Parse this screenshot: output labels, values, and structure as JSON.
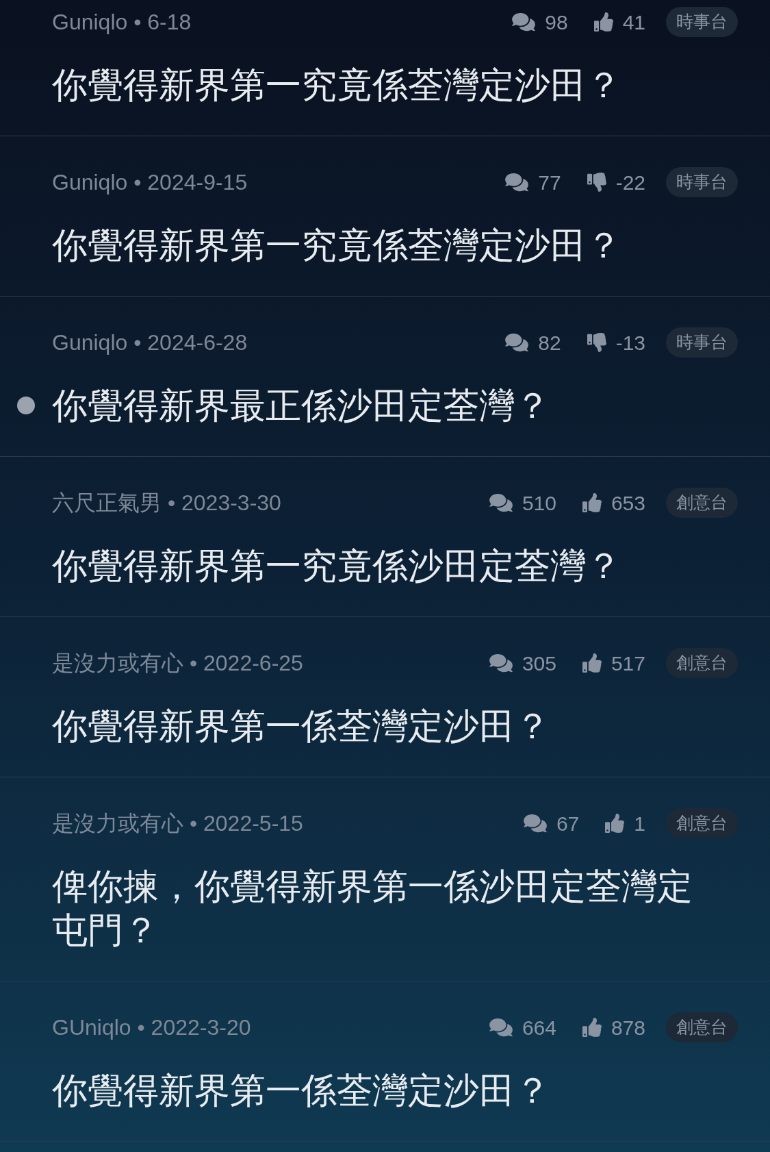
{
  "threads": [
    {
      "byline": "Guniqlo • 6-18",
      "comments": "98",
      "kind": "upvotes",
      "votes": "41",
      "board": "時事台",
      "title": "你覺得新界第一究竟係荃灣定沙田？",
      "unread": false
    },
    {
      "byline": "Guniqlo • 2024-9-15",
      "comments": "77",
      "kind": "downvotes",
      "votes": "-22",
      "board": "時事台",
      "title": "你覺得新界第一究竟係荃灣定沙田？",
      "unread": false
    },
    {
      "byline": "Guniqlo • 2024-6-28",
      "comments": "82",
      "kind": "downvotes",
      "votes": "-13",
      "board": "時事台",
      "title": "你覺得新界最正係沙田定荃灣？",
      "unread": true
    },
    {
      "byline": "六尺正氣男 • 2023-3-30",
      "comments": "510",
      "kind": "upvotes",
      "votes": "653",
      "board": "創意台",
      "title": "你覺得新界第一究竟係沙田定荃灣？",
      "unread": false
    },
    {
      "byline": "是沒力或有心 • 2022-6-25",
      "comments": "305",
      "kind": "upvotes",
      "votes": "517",
      "board": "創意台",
      "title": "你覺得新界第一係荃灣定沙田？",
      "unread": false
    },
    {
      "byline": "是沒力或有心 • 2022-5-15",
      "comments": "67",
      "kind": "upvotes",
      "votes": "1",
      "board": "創意台",
      "title": "俾你揀，你覺得新界第一係沙田定荃灣定屯門？",
      "unread": false
    },
    {
      "byline": "GUniqlo • 2022-3-20",
      "comments": "664",
      "kind": "upvotes",
      "votes": "878",
      "board": "創意台",
      "title": "你覺得新界第一係荃灣定沙田？",
      "unread": false
    }
  ]
}
